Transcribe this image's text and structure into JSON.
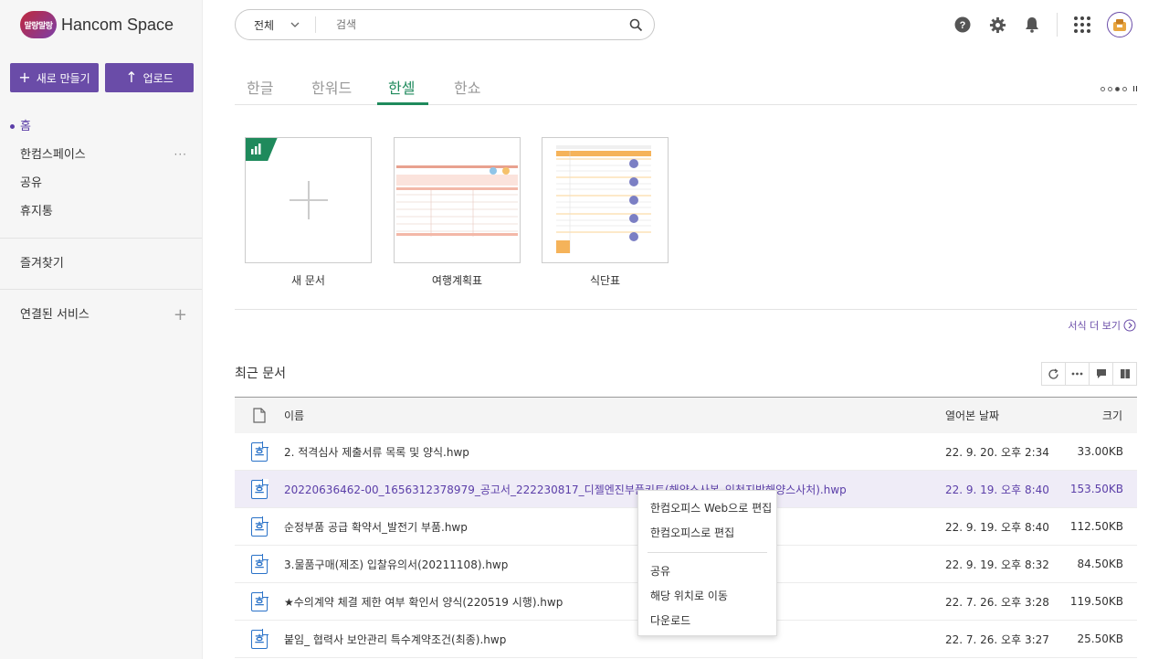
{
  "brand": {
    "badge": "말랑말랑",
    "name": "Hancom Space"
  },
  "sidebar": {
    "new_label": "새로 만들기",
    "upload_label": "업로드",
    "items": [
      {
        "label": "홈"
      },
      {
        "label": "한컴스페이스",
        "more": "···"
      },
      {
        "label": "공유"
      },
      {
        "label": "휴지통"
      }
    ],
    "favorites_label": "즐겨찾기",
    "connected_label": "연결된 서비스"
  },
  "search": {
    "scope": "전체",
    "placeholder": "검색"
  },
  "tabs": [
    {
      "label": "한글"
    },
    {
      "label": "한워드"
    },
    {
      "label": "한셀"
    },
    {
      "label": "한쇼"
    }
  ],
  "templates": [
    {
      "label": "새 문서"
    },
    {
      "label": "여행계획표"
    },
    {
      "label": "식단표"
    }
  ],
  "more_templates": "서식 더 보기",
  "recent": {
    "title": "최근 문서",
    "columns": {
      "name": "이름",
      "date": "열어본 날짜",
      "size": "크기"
    },
    "icon_glyph": "흐",
    "rows": [
      {
        "name": "2. 적격심사 제출서류 목록 및 양식.hwp",
        "date": "22. 9. 20. 오후 2:34",
        "size": "33.00KB"
      },
      {
        "name": "20220636462-00_1656312378979_공고서_222230817_디젤엔진부품키트(해양스사본_인천지방해양스사처).hwp",
        "date": "22. 9. 19. 오후 8:40",
        "size": "153.50KB"
      },
      {
        "name": "순정부품 공급 확약서_발전기 부품.hwp",
        "date": "22. 9. 19. 오후 8:40",
        "size": "112.50KB"
      },
      {
        "name": "3.물품구매(제조) 입찰유의서(20211108).hwp",
        "date": "22. 9. 19. 오후 8:32",
        "size": "84.50KB"
      },
      {
        "name": "★수의계약 체결 제한 여부 확인서 양식(220519 시행).hwp",
        "date": "22. 7. 26. 오후 3:28",
        "size": "119.50KB"
      },
      {
        "name": "붙임_ 협력사 보안관리 특수계약조건(최종).hwp",
        "date": "22. 7. 26. 오후 3:27",
        "size": "25.50KB"
      }
    ]
  },
  "context_menu": {
    "items": [
      "한컴오피스 Web으로 편집",
      "한컴오피스로 편집",
      "공유",
      "해당 위치로 이동",
      "다운로드"
    ]
  }
}
